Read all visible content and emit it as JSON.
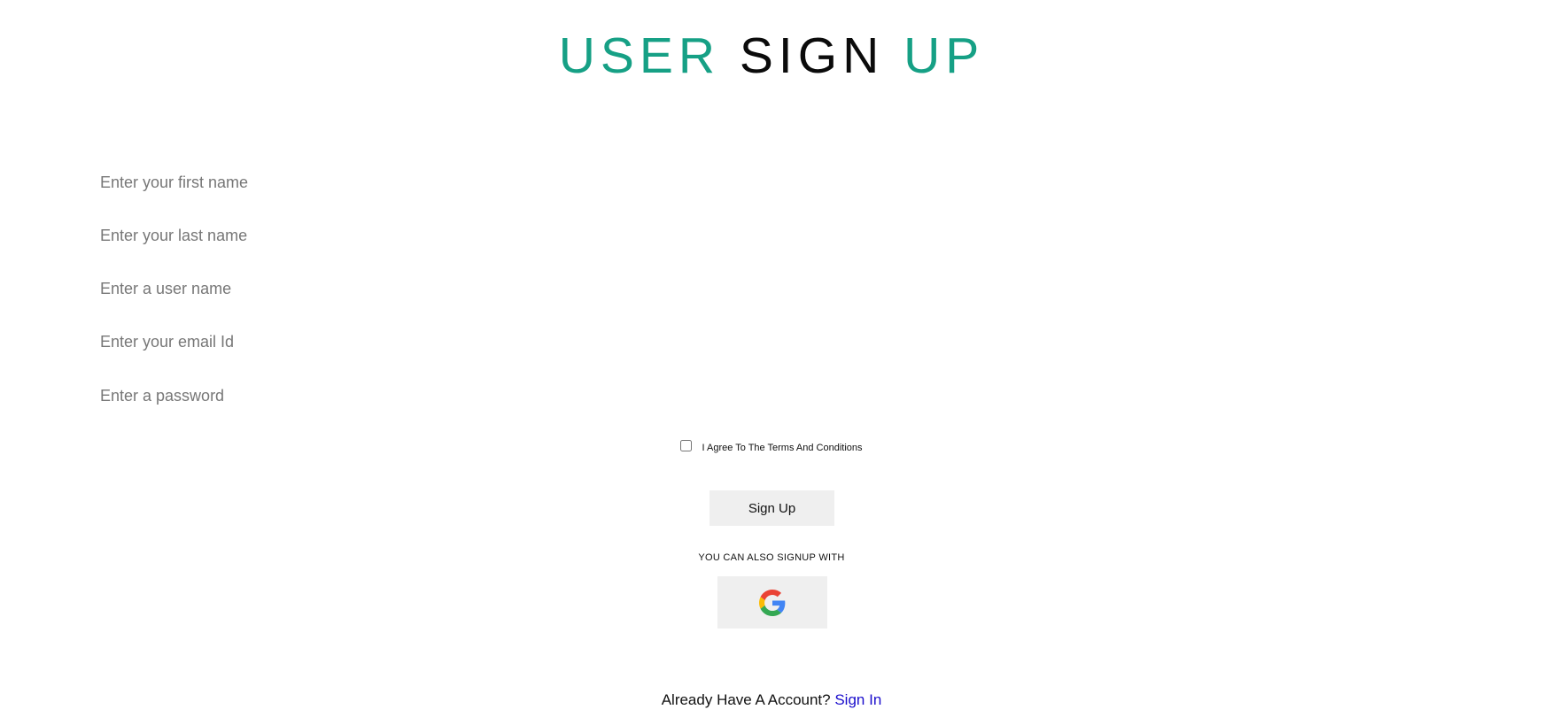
{
  "header": {
    "title_part1": "USER",
    "title_part2": "SIGN",
    "title_part3": "UP",
    "accent_color": "#16a085"
  },
  "form": {
    "first_name_placeholder": "Enter your first name",
    "last_name_placeholder": "Enter your last name",
    "username_placeholder": "Enter a user name",
    "email_placeholder": "Enter your email Id",
    "password_placeholder": "Enter a password",
    "terms_label": "I Agree To The Terms And Conditions",
    "terms_checked": false,
    "signup_label": "Sign Up"
  },
  "social": {
    "label": "YOU CAN ALSO SIGNUP WITH",
    "provider_icon": "google-icon"
  },
  "footer": {
    "prompt": "Already Have A Account?",
    "signin_label": "Sign In",
    "link_color": "#1a0dcc"
  }
}
